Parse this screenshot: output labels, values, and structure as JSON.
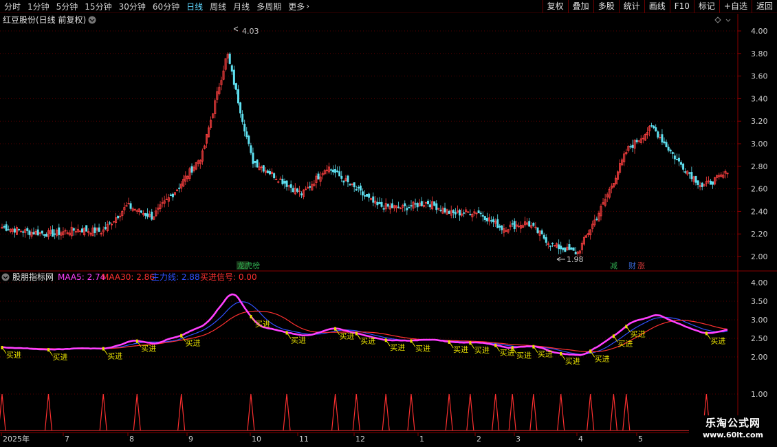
{
  "toolbar": {
    "periods": [
      "分时",
      "1分钟",
      "5分钟",
      "15分钟",
      "30分钟",
      "60分钟",
      "日线",
      "周线",
      "月线",
      "多周期",
      "更多"
    ],
    "active_period": "日线",
    "tools": [
      "复权",
      "叠加",
      "多股",
      "统计",
      "画线",
      "F10",
      "标记",
      "+自选",
      "返回"
    ]
  },
  "main_panel": {
    "title": "红豆股份(日线 前复权)",
    "price_axis": [
      "4.00",
      "3.80",
      "3.60",
      "3.40",
      "3.20",
      "3.00",
      "2.80",
      "2.60",
      "2.40",
      "2.20",
      "2.00"
    ],
    "high_label": "4.03",
    "low_label": "1.98",
    "event_markers": [
      {
        "text": "龙虎榜",
        "color": "#2fa84f"
      },
      {
        "text": "减",
        "color": "#2fa84f"
      },
      {
        "text": "财",
        "color": "#3a6ad8"
      },
      {
        "text": "涨",
        "color": "#d83a3a"
      }
    ],
    "up_color": "#ff4040",
    "down_color": "#5fe0f0"
  },
  "indicator_panel": {
    "name": "股朋指标网",
    "legend": [
      {
        "label": "MAA5: 2.74",
        "color": "#ff40ff"
      },
      {
        "label": "MAA30: 2.86",
        "color": "#ff3030"
      },
      {
        "label": "主力线: 2.88",
        "color": "#3050ff"
      },
      {
        "label": "买进信号: 0.00",
        "color": "#ff3030"
      }
    ],
    "axis": [
      "4.00",
      "3.50",
      "3.00",
      "2.50",
      "2.00",
      "1.00"
    ],
    "signal_label": "买进",
    "signal_count": 23
  },
  "time_axis": [
    "2025年",
    "7",
    "8",
    "9",
    "10",
    "11",
    "12",
    "1",
    "2",
    "3",
    "4",
    "5"
  ],
  "watermark": {
    "line1": "乐淘公式网",
    "line2": "www.60lt.com"
  },
  "chart_data": {
    "type": "candlestick",
    "title": "红豆股份(日线 前复权)",
    "ylim": [
      1.95,
      4.08
    ],
    "annotations": {
      "high": 4.03,
      "low": 1.98
    },
    "close_path": [
      {
        "x": "2025-06",
        "y": 2.26
      },
      {
        "x": "2025-06-mid",
        "y": 2.22
      },
      {
        "x": "2025-07",
        "y": 2.2
      },
      {
        "x": "2025-07-mid",
        "y": 2.24
      },
      {
        "x": "2025-08",
        "y": 2.22
      },
      {
        "x": "2025-08-mid",
        "y": 2.45
      },
      {
        "x": "2025-08-end",
        "y": 2.35
      },
      {
        "x": "2025-09",
        "y": 2.6
      },
      {
        "x": "2025-09-mid",
        "y": 2.9
      },
      {
        "x": "2025-09-peak",
        "y": 3.8
      },
      {
        "x": "2025-10",
        "y": 2.85
      },
      {
        "x": "2025-10-mid",
        "y": 2.7
      },
      {
        "x": "2025-11",
        "y": 2.55
      },
      {
        "x": "2025-11-mid",
        "y": 2.8
      },
      {
        "x": "2025-12",
        "y": 2.62
      },
      {
        "x": "2025-12-mid",
        "y": 2.45
      },
      {
        "x": "2026-01",
        "y": 2.43
      },
      {
        "x": "2026-01-mid",
        "y": 2.48
      },
      {
        "x": "2026-02",
        "y": 2.38
      },
      {
        "x": "2026-02-mid",
        "y": 2.4
      },
      {
        "x": "2026-03",
        "y": 2.25
      },
      {
        "x": "2026-03-mid",
        "y": 2.3
      },
      {
        "x": "2026-04",
        "y": 2.1
      },
      {
        "x": "2026-04-low",
        "y": 2.03
      },
      {
        "x": "2026-04-end",
        "y": 2.45
      },
      {
        "x": "2026-05",
        "y": 2.95
      },
      {
        "x": "2026-05-mid",
        "y": 3.15
      },
      {
        "x": "2026-05-end",
        "y": 2.85
      },
      {
        "x": "2026-06",
        "y": 2.62
      },
      {
        "x": "2026-06-last",
        "y": 2.74
      }
    ]
  }
}
